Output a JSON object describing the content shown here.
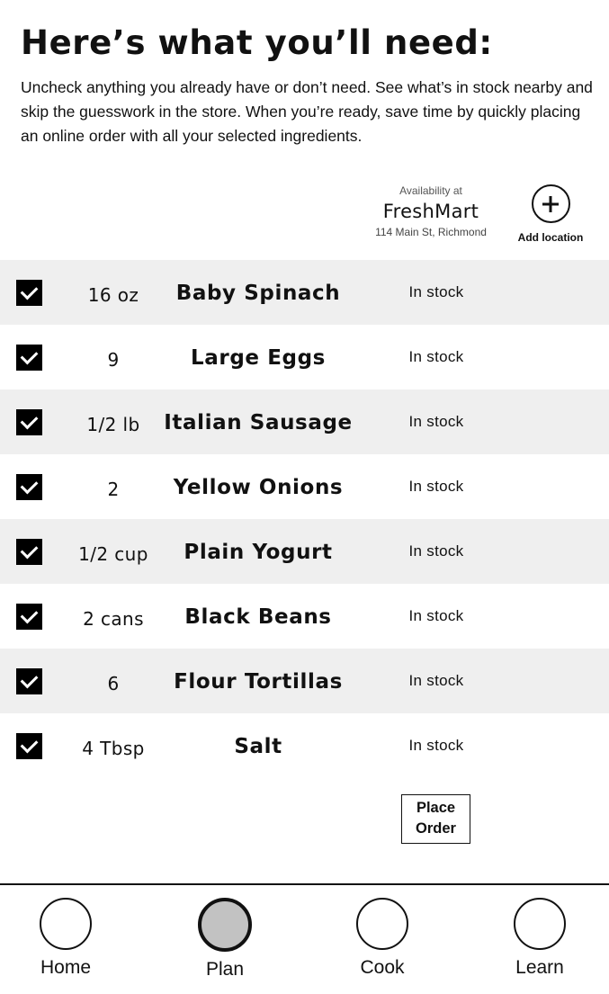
{
  "header": {
    "title": "Here’s what you’ll need:",
    "intro": "Uncheck anything you already have or don’t need.  See what’s in stock nearby and skip the guesswork in the store.  When you’re ready, save time by quickly placing an online order with all your selected ingredients."
  },
  "store": {
    "availability_label": "Availability at",
    "name": "FreshMart",
    "address": "114 Main St, Richmond",
    "add_location_label": "Add location",
    "add_location_icon": "plus-circle-icon"
  },
  "ingredients": [
    {
      "checked": true,
      "qty": "16 oz",
      "name": "Baby Spinach",
      "status": "In stock"
    },
    {
      "checked": true,
      "qty": "9",
      "name": "Large Eggs",
      "status": "In stock"
    },
    {
      "checked": true,
      "qty": "1/2 lb",
      "name": "Italian Sausage",
      "status": "In stock"
    },
    {
      "checked": true,
      "qty": "2",
      "name": "Yellow Onions",
      "status": "In stock"
    },
    {
      "checked": true,
      "qty": "1/2 cup",
      "name": "Plain Yogurt",
      "status": "In stock"
    },
    {
      "checked": true,
      "qty": "2 cans",
      "name": "Black Beans",
      "status": "In stock"
    },
    {
      "checked": true,
      "qty": "6",
      "name": "Flour Tortillas",
      "status": "In stock"
    },
    {
      "checked": true,
      "qty": "4 Tbsp",
      "name": "Salt",
      "status": "In stock"
    }
  ],
  "actions": {
    "place_order_line1": "Place",
    "place_order_line2": "Order"
  },
  "nav": {
    "items": [
      {
        "label": "Home",
        "icon": "home-circle-icon",
        "active": false
      },
      {
        "label": "Plan",
        "icon": "plan-circle-icon",
        "active": true
      },
      {
        "label": "Cook",
        "icon": "cook-circle-icon",
        "active": false
      },
      {
        "label": "Learn",
        "icon": "learn-circle-icon",
        "active": false
      }
    ]
  },
  "colors": {
    "row_alt_bg": "#efefef",
    "checkbox": "#000000",
    "active_nav_fill": "#c2c2c2"
  }
}
